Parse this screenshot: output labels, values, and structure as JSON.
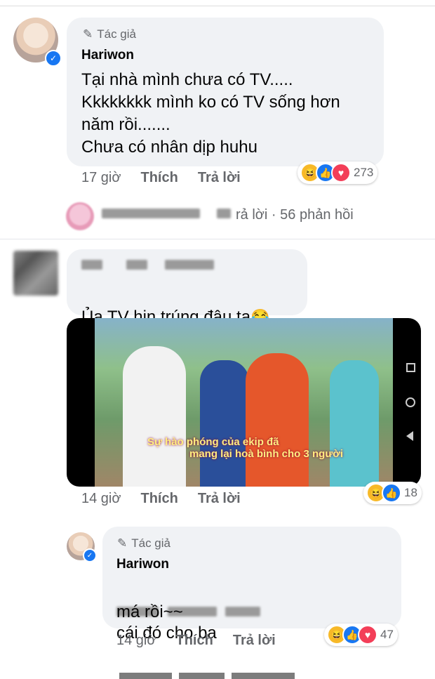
{
  "comment1": {
    "author_badge": "Tác giả",
    "author": "Hariwon",
    "text": "Tại nhà mình chưa có TV.....\nKkkkkkkk mình ko có TV sống hơn\nnăm rồi.......\nChưa có nhân dịp huhu",
    "time": "17 giờ",
    "like": "Thích",
    "reply": "Trả lời",
    "reaction_count": "273"
  },
  "reply_summary": {
    "replied_fragment": "rả lời",
    "separator": "·",
    "count_text": "56 phản hồi"
  },
  "comment2": {
    "text": "Ủa TV hịn trúng đâu ta",
    "emoji": "😂",
    "time": "14 giờ",
    "like": "Thích",
    "reply": "Trả lời",
    "reaction_count": "18",
    "video_caption_line1": "Sự hào phóng của ekip đã",
    "video_caption_line2": "mang lại hoà bình cho 3 người"
  },
  "comment3": {
    "author_badge": "Tác giả",
    "author": "Hariwon",
    "text_visible": "cái đó cho ba",
    "text_line2": "má rồi~~",
    "time": "14 giờ",
    "like": "Thích",
    "reply": "Trả lời",
    "reaction_count": "47"
  },
  "colors": {
    "bubble": "#f0f2f5",
    "meta": "#65676b",
    "like_blue": "#1877f2",
    "love_red": "#f33e58",
    "haha_yellow": "#f7b928"
  },
  "icons": [
    "pen-icon",
    "verified-icon",
    "haha-icon",
    "like-icon",
    "love-icon",
    "android-back-icon",
    "android-home-icon",
    "android-recent-icon"
  ]
}
